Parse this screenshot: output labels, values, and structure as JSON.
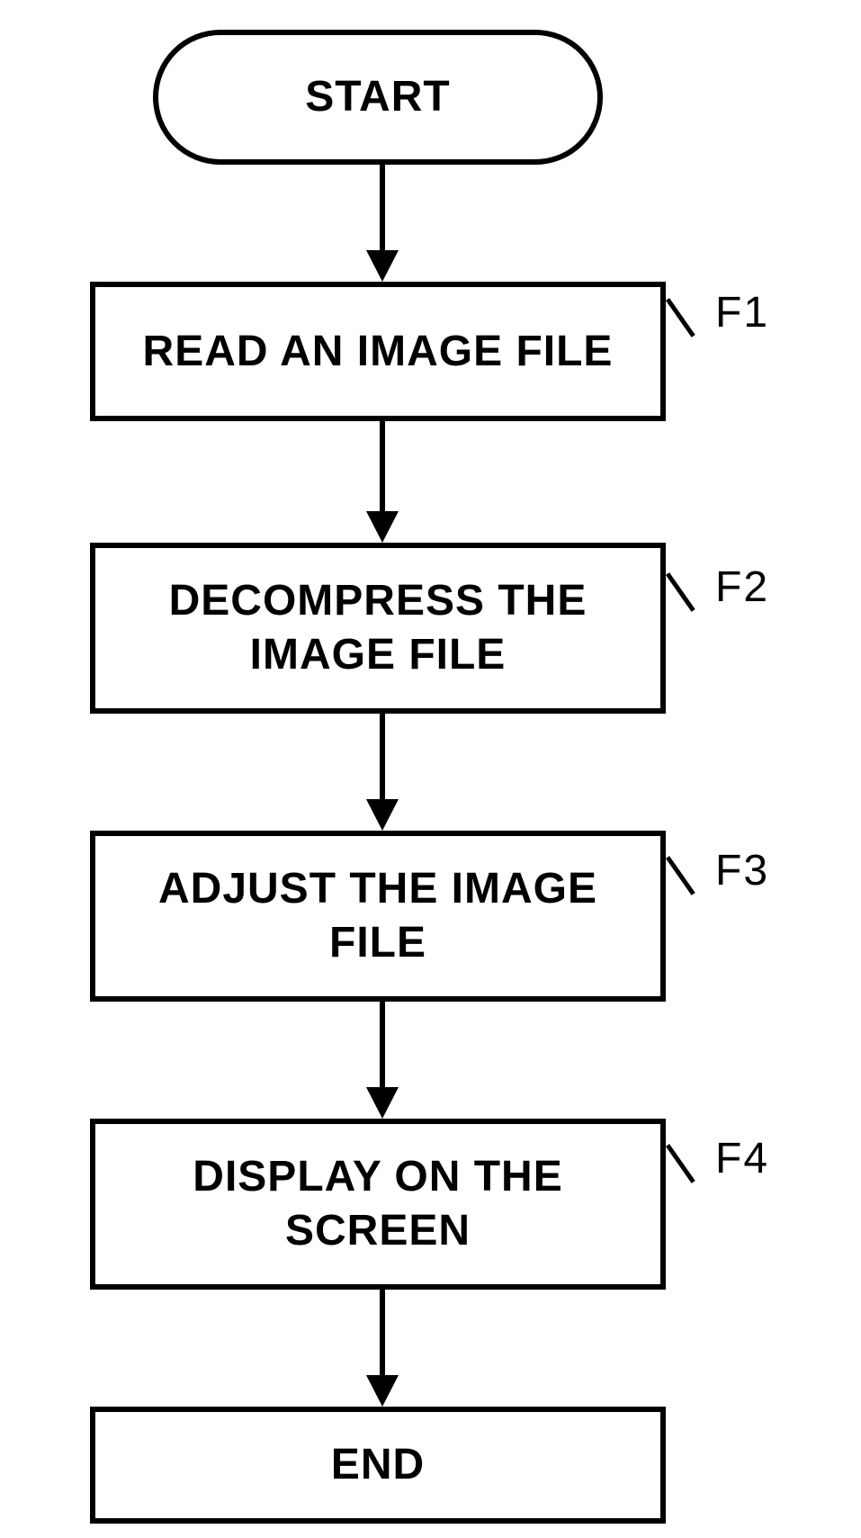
{
  "flow": {
    "start": "START",
    "steps": [
      {
        "id": "F1",
        "text": "READ AN IMAGE FILE"
      },
      {
        "id": "F2",
        "text": "DECOMPRESS THE IMAGE FILE"
      },
      {
        "id": "F3",
        "text": "ADJUST THE IMAGE FILE"
      },
      {
        "id": "F4",
        "text": "DISPLAY ON THE SCREEN"
      }
    ],
    "end": "END"
  }
}
